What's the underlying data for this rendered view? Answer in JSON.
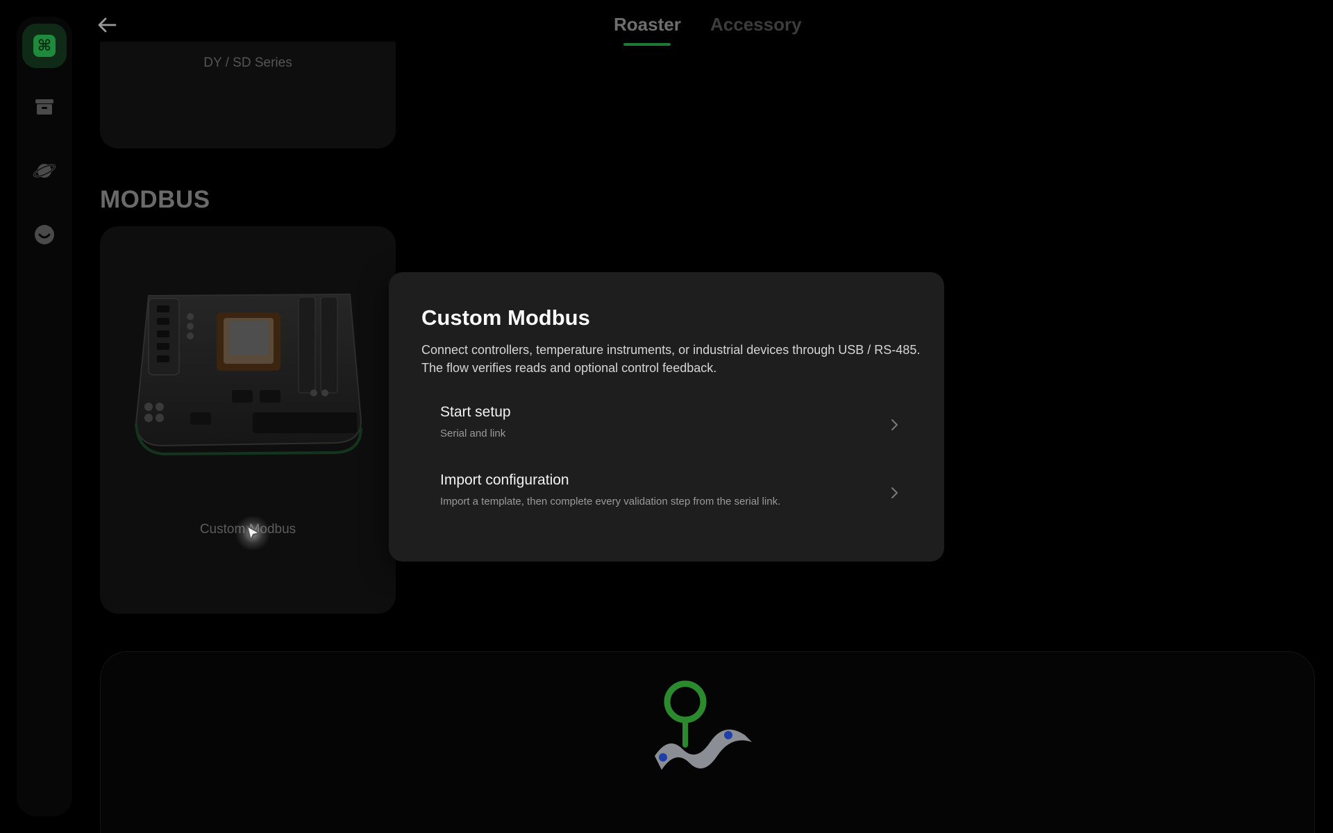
{
  "tabs": [
    {
      "label": "Roaster",
      "active": true
    },
    {
      "label": "Accessory",
      "active": false
    }
  ],
  "sidebar": {
    "items": [
      {
        "icon": "command-icon",
        "active": true
      },
      {
        "icon": "archive-box-icon",
        "active": false
      },
      {
        "icon": "planet-icon",
        "active": false
      },
      {
        "icon": "smile-face-icon",
        "active": false
      }
    ]
  },
  "cards": {
    "top_label": "DY / SD Series",
    "section_title": "MODBUS",
    "modbus_label": "Custom Modbus"
  },
  "popover": {
    "title": "Custom Modbus",
    "description": "Connect controllers, temperature instruments, or industrial devices through USB / RS-485. The flow verifies reads and optional control feedback.",
    "items": [
      {
        "title": "Start setup",
        "subtitle": "Serial and link"
      },
      {
        "title": "Import configuration",
        "subtitle": "Import a template, then complete every validation step from the serial link."
      }
    ]
  },
  "colors": {
    "accent": "#1f8a3c",
    "background": "#000000",
    "popover": "#1e1e1e"
  }
}
